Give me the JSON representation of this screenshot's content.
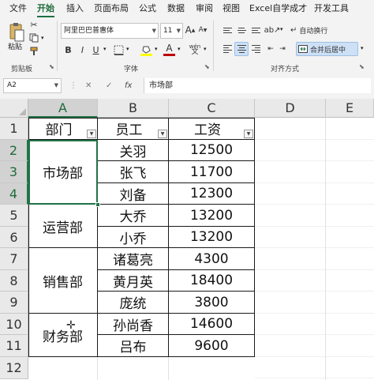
{
  "menu": {
    "tabs": [
      "文件",
      "开始",
      "插入",
      "页面布局",
      "公式",
      "数据",
      "审阅",
      "视图",
      "Excel自学成才",
      "开发工具"
    ],
    "active": "开始"
  },
  "ribbon": {
    "clipboard": {
      "paste_label": "粘贴",
      "group_label": "剪贴板"
    },
    "font": {
      "font_name": "阿里巴巴普惠体",
      "font_size": "11",
      "grow_label": "A",
      "shrink_label": "A",
      "bold": "B",
      "italic": "I",
      "underline": "U",
      "group_label": "字体",
      "font_color": "#c00000",
      "fill_color": "#ffff00",
      "wen_label": "wén"
    },
    "alignment": {
      "wrap_label": "自动换行",
      "merge_label": "合并后居中",
      "group_label": "对齐方式"
    }
  },
  "formula_bar": {
    "name_box": "A2",
    "cancel": "✕",
    "enter": "✓",
    "fx": "fx",
    "value": "市场部"
  },
  "grid": {
    "columns": [
      "A",
      "B",
      "C",
      "D",
      "E"
    ],
    "selected_column": "A",
    "rows": [
      "1",
      "2",
      "3",
      "4",
      "5",
      "6",
      "7",
      "8",
      "9",
      "10",
      "11",
      "12"
    ],
    "selected_rows": [
      "2",
      "3",
      "4"
    ],
    "header": {
      "dept": "部门",
      "staff": "员工",
      "salary": "工资"
    },
    "departments": [
      "市场部",
      "运营部",
      "销售部",
      "财务部"
    ],
    "staff": [
      "关羽",
      "张飞",
      "刘备",
      "大乔",
      "小乔",
      "诸葛亮",
      "黄月英",
      "庞统",
      "孙尚香",
      "吕布"
    ],
    "salary": [
      "12500",
      "11700",
      "12300",
      "13200",
      "13200",
      "4300",
      "18400",
      "3800",
      "14600",
      "9600"
    ]
  },
  "colors": {
    "accent": "#217346",
    "selection_header": "#d2d2d2"
  }
}
